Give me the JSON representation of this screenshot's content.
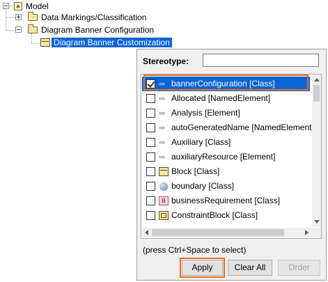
{
  "tree": {
    "model_label": "Model",
    "data_markings_label": "Data Markings/Classification",
    "diagram_banner_config_label": "Diagram Banner Configuration",
    "diagram_banner_customization_label": "Diagram Banner Customization"
  },
  "popup": {
    "stereotype_label": "Stereotype:",
    "stereotype_input_value": "",
    "items": [
      {
        "label": "bannerConfiguration [Class]",
        "icon": "stereotype-icon",
        "checked": true,
        "selected": true
      },
      {
        "label": "Allocated [NamedElement]",
        "icon": "stereotype-icon",
        "checked": false,
        "selected": false
      },
      {
        "label": "Analysis [Element]",
        "icon": "stereotype-icon",
        "checked": false,
        "selected": false
      },
      {
        "label": "autoGeneratedName [NamedElement]",
        "icon": "stereotype-icon",
        "checked": false,
        "selected": false
      },
      {
        "label": "Auxiliary [Class]",
        "icon": "stereotype-icon",
        "checked": false,
        "selected": false
      },
      {
        "label": "auxiliaryResource [Element]",
        "icon": "stereotype-icon",
        "checked": false,
        "selected": false
      },
      {
        "label": "Block [Class]",
        "icon": "block-icon",
        "checked": false,
        "selected": false
      },
      {
        "label": "boundary [Class]",
        "icon": "boundary-icon",
        "checked": false,
        "selected": false
      },
      {
        "label": "businessRequirement [Class]",
        "icon": "business-requirement-icon",
        "checked": false,
        "selected": false
      },
      {
        "label": "ConstraintBlock [Class]",
        "icon": "constraint-block-icon",
        "checked": false,
        "selected": false
      }
    ],
    "hint": "(press Ctrl+Space to select)",
    "buttons": {
      "apply": "Apply",
      "clear_all": "Clear All",
      "order": "Order"
    },
    "stereo_glyph": "«»",
    "bizreq_glyph": "B"
  }
}
